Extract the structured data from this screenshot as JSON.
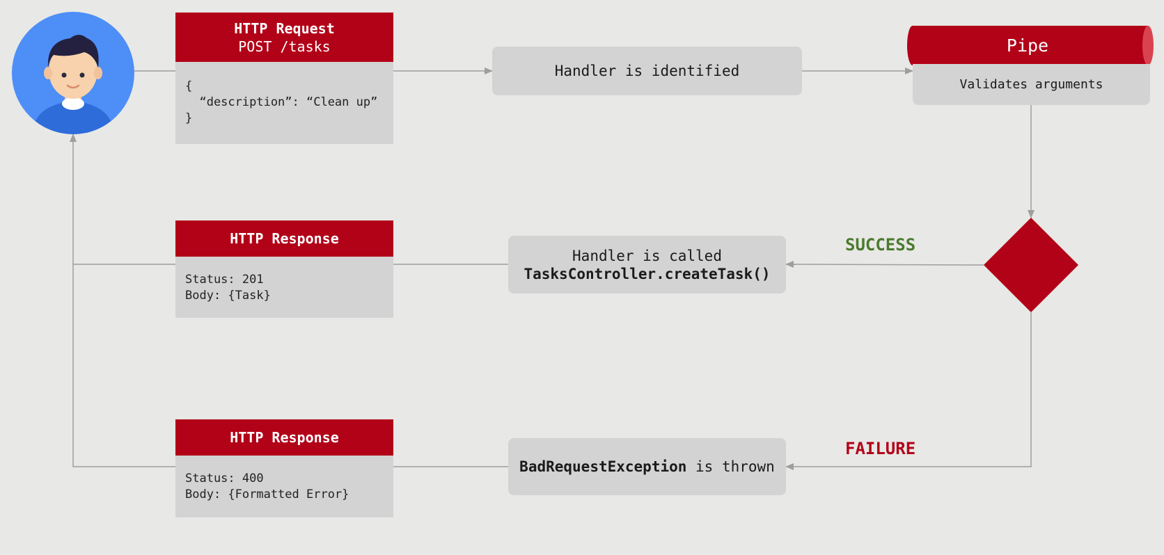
{
  "request_card": {
    "title": "HTTP Request",
    "subtitle": "POST /tasks",
    "body_lines": [
      "{",
      "  “description”: “Clean up”",
      "}"
    ]
  },
  "handler_identified": "Handler is identified",
  "pipe": {
    "title": "Pipe",
    "description": "Validates arguments"
  },
  "handler_called": {
    "line1": "Handler is called",
    "method": "TasksController.createTask()"
  },
  "success_label": "SUCCESS",
  "failure_label": "FAILURE",
  "response_success": {
    "title": "HTTP Response",
    "body_lines": [
      "Status: 201",
      "Body: {Task}"
    ]
  },
  "exception": {
    "name": "BadRequestException",
    "suffix": " is thrown"
  },
  "response_failure": {
    "title": "HTTP Response",
    "body_lines": [
      "Status: 400",
      "Body: {Formatted Error}"
    ]
  },
  "colors": {
    "accent_red": "#b20218",
    "success_green": "#4a7a2c",
    "failure_red": "#b20218",
    "card_gray": "#d3d3d3",
    "avatar_blue": "#4e8ef7"
  },
  "icons": {
    "user": "user-avatar-icon",
    "decision": "decision-diamond"
  }
}
